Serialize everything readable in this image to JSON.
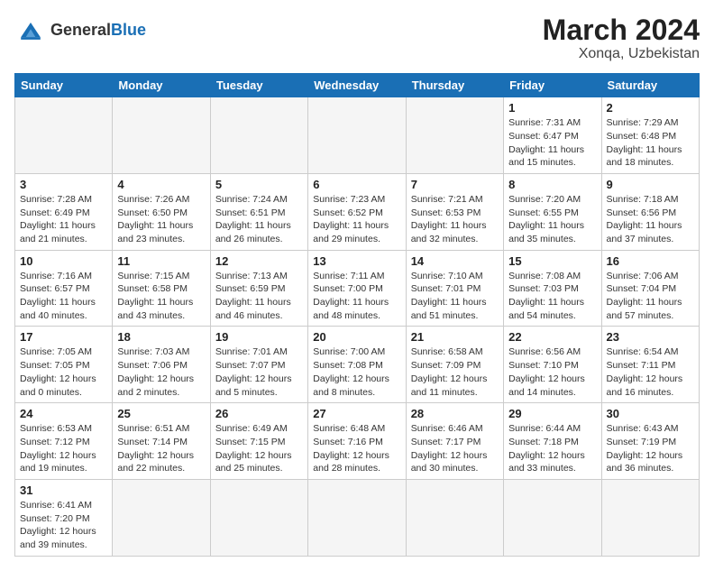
{
  "header": {
    "logo_general": "General",
    "logo_blue": "Blue",
    "month_year": "March 2024",
    "location": "Xonqa, Uzbekistan"
  },
  "weekdays": [
    "Sunday",
    "Monday",
    "Tuesday",
    "Wednesday",
    "Thursday",
    "Friday",
    "Saturday"
  ],
  "weeks": [
    [
      {
        "day": "",
        "info": ""
      },
      {
        "day": "",
        "info": ""
      },
      {
        "day": "",
        "info": ""
      },
      {
        "day": "",
        "info": ""
      },
      {
        "day": "",
        "info": ""
      },
      {
        "day": "1",
        "info": "Sunrise: 7:31 AM\nSunset: 6:47 PM\nDaylight: 11 hours and 15 minutes."
      },
      {
        "day": "2",
        "info": "Sunrise: 7:29 AM\nSunset: 6:48 PM\nDaylight: 11 hours and 18 minutes."
      }
    ],
    [
      {
        "day": "3",
        "info": "Sunrise: 7:28 AM\nSunset: 6:49 PM\nDaylight: 11 hours and 21 minutes."
      },
      {
        "day": "4",
        "info": "Sunrise: 7:26 AM\nSunset: 6:50 PM\nDaylight: 11 hours and 23 minutes."
      },
      {
        "day": "5",
        "info": "Sunrise: 7:24 AM\nSunset: 6:51 PM\nDaylight: 11 hours and 26 minutes."
      },
      {
        "day": "6",
        "info": "Sunrise: 7:23 AM\nSunset: 6:52 PM\nDaylight: 11 hours and 29 minutes."
      },
      {
        "day": "7",
        "info": "Sunrise: 7:21 AM\nSunset: 6:53 PM\nDaylight: 11 hours and 32 minutes."
      },
      {
        "day": "8",
        "info": "Sunrise: 7:20 AM\nSunset: 6:55 PM\nDaylight: 11 hours and 35 minutes."
      },
      {
        "day": "9",
        "info": "Sunrise: 7:18 AM\nSunset: 6:56 PM\nDaylight: 11 hours and 37 minutes."
      }
    ],
    [
      {
        "day": "10",
        "info": "Sunrise: 7:16 AM\nSunset: 6:57 PM\nDaylight: 11 hours and 40 minutes."
      },
      {
        "day": "11",
        "info": "Sunrise: 7:15 AM\nSunset: 6:58 PM\nDaylight: 11 hours and 43 minutes."
      },
      {
        "day": "12",
        "info": "Sunrise: 7:13 AM\nSunset: 6:59 PM\nDaylight: 11 hours and 46 minutes."
      },
      {
        "day": "13",
        "info": "Sunrise: 7:11 AM\nSunset: 7:00 PM\nDaylight: 11 hours and 48 minutes."
      },
      {
        "day": "14",
        "info": "Sunrise: 7:10 AM\nSunset: 7:01 PM\nDaylight: 11 hours and 51 minutes."
      },
      {
        "day": "15",
        "info": "Sunrise: 7:08 AM\nSunset: 7:03 PM\nDaylight: 11 hours and 54 minutes."
      },
      {
        "day": "16",
        "info": "Sunrise: 7:06 AM\nSunset: 7:04 PM\nDaylight: 11 hours and 57 minutes."
      }
    ],
    [
      {
        "day": "17",
        "info": "Sunrise: 7:05 AM\nSunset: 7:05 PM\nDaylight: 12 hours and 0 minutes."
      },
      {
        "day": "18",
        "info": "Sunrise: 7:03 AM\nSunset: 7:06 PM\nDaylight: 12 hours and 2 minutes."
      },
      {
        "day": "19",
        "info": "Sunrise: 7:01 AM\nSunset: 7:07 PM\nDaylight: 12 hours and 5 minutes."
      },
      {
        "day": "20",
        "info": "Sunrise: 7:00 AM\nSunset: 7:08 PM\nDaylight: 12 hours and 8 minutes."
      },
      {
        "day": "21",
        "info": "Sunrise: 6:58 AM\nSunset: 7:09 PM\nDaylight: 12 hours and 11 minutes."
      },
      {
        "day": "22",
        "info": "Sunrise: 6:56 AM\nSunset: 7:10 PM\nDaylight: 12 hours and 14 minutes."
      },
      {
        "day": "23",
        "info": "Sunrise: 6:54 AM\nSunset: 7:11 PM\nDaylight: 12 hours and 16 minutes."
      }
    ],
    [
      {
        "day": "24",
        "info": "Sunrise: 6:53 AM\nSunset: 7:12 PM\nDaylight: 12 hours and 19 minutes."
      },
      {
        "day": "25",
        "info": "Sunrise: 6:51 AM\nSunset: 7:14 PM\nDaylight: 12 hours and 22 minutes."
      },
      {
        "day": "26",
        "info": "Sunrise: 6:49 AM\nSunset: 7:15 PM\nDaylight: 12 hours and 25 minutes."
      },
      {
        "day": "27",
        "info": "Sunrise: 6:48 AM\nSunset: 7:16 PM\nDaylight: 12 hours and 28 minutes."
      },
      {
        "day": "28",
        "info": "Sunrise: 6:46 AM\nSunset: 7:17 PM\nDaylight: 12 hours and 30 minutes."
      },
      {
        "day": "29",
        "info": "Sunrise: 6:44 AM\nSunset: 7:18 PM\nDaylight: 12 hours and 33 minutes."
      },
      {
        "day": "30",
        "info": "Sunrise: 6:43 AM\nSunset: 7:19 PM\nDaylight: 12 hours and 36 minutes."
      }
    ],
    [
      {
        "day": "31",
        "info": "Sunrise: 6:41 AM\nSunset: 7:20 PM\nDaylight: 12 hours and 39 minutes."
      },
      {
        "day": "",
        "info": ""
      },
      {
        "day": "",
        "info": ""
      },
      {
        "day": "",
        "info": ""
      },
      {
        "day": "",
        "info": ""
      },
      {
        "day": "",
        "info": ""
      },
      {
        "day": "",
        "info": ""
      }
    ]
  ]
}
